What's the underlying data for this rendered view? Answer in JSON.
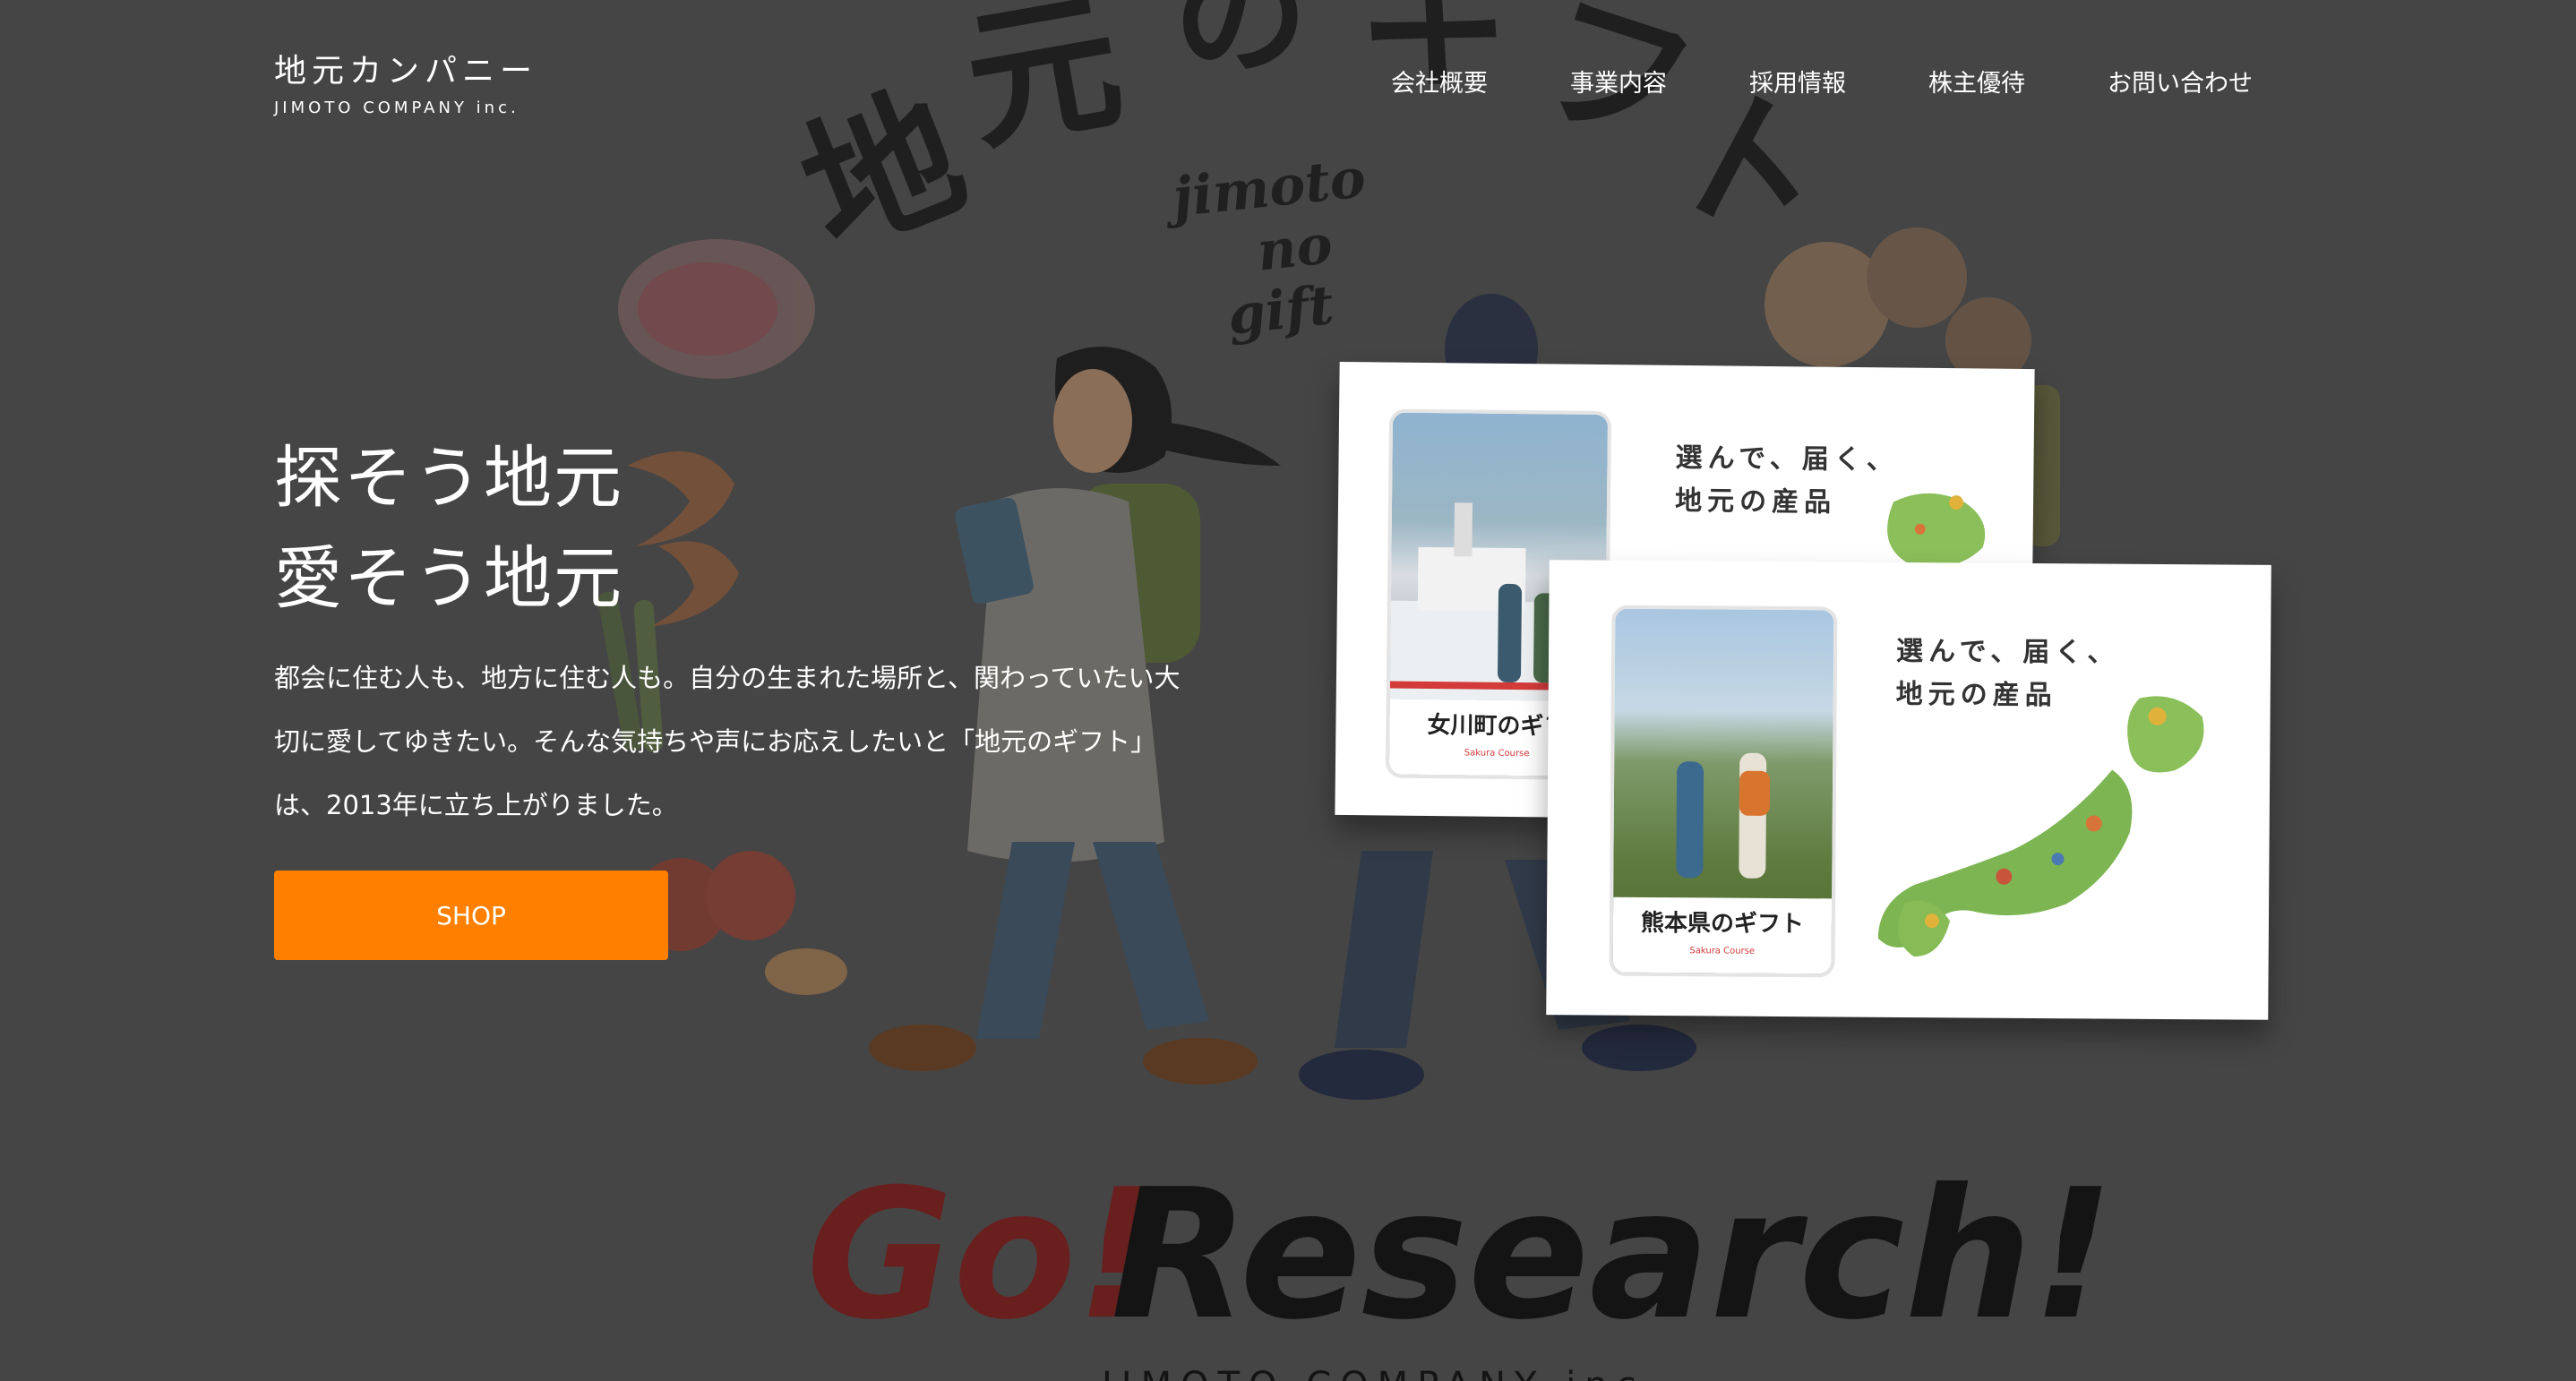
{
  "header": {
    "logo_jp": "地元カンパニー",
    "logo_en": "JIMOTO COMPANY inc.",
    "nav": [
      {
        "label": "会社概要"
      },
      {
        "label": "事業内容"
      },
      {
        "label": "採用情報"
      },
      {
        "label": "株主優待"
      },
      {
        "label": "お問い合わせ"
      }
    ]
  },
  "hero": {
    "title_line1": "探そう地元",
    "title_line2": "愛そう地元",
    "description": "都会に住む人も、地方に住む人も。自分の生まれた場所と、関わっていたい大切に愛してゆきたい。そんな気持ちや声にお応えしたいと「地元のギフト」は、2013年に立ち上がりました。",
    "shop_label": "SHOP"
  },
  "poster": {
    "title": "地元のギフト",
    "script": [
      "jimoto",
      "no",
      "gift"
    ],
    "go": "Go!",
    "research": "Research!",
    "footer": "JIMOTO COMPANY inc."
  },
  "gift_boxes": [
    {
      "catch_line1": "選んで、届く、",
      "catch_line2": "地元の産品",
      "name": "女川町のギフ",
      "sub": "Sakura Course"
    },
    {
      "catch_line1": "選んで、届く、",
      "catch_line2": "地元の産品",
      "name": "熊本県のギフト",
      "sub": "Sakura Course"
    }
  ],
  "colors": {
    "background": "#454545",
    "accent": "#ff8000",
    "text": "#ffffff"
  }
}
